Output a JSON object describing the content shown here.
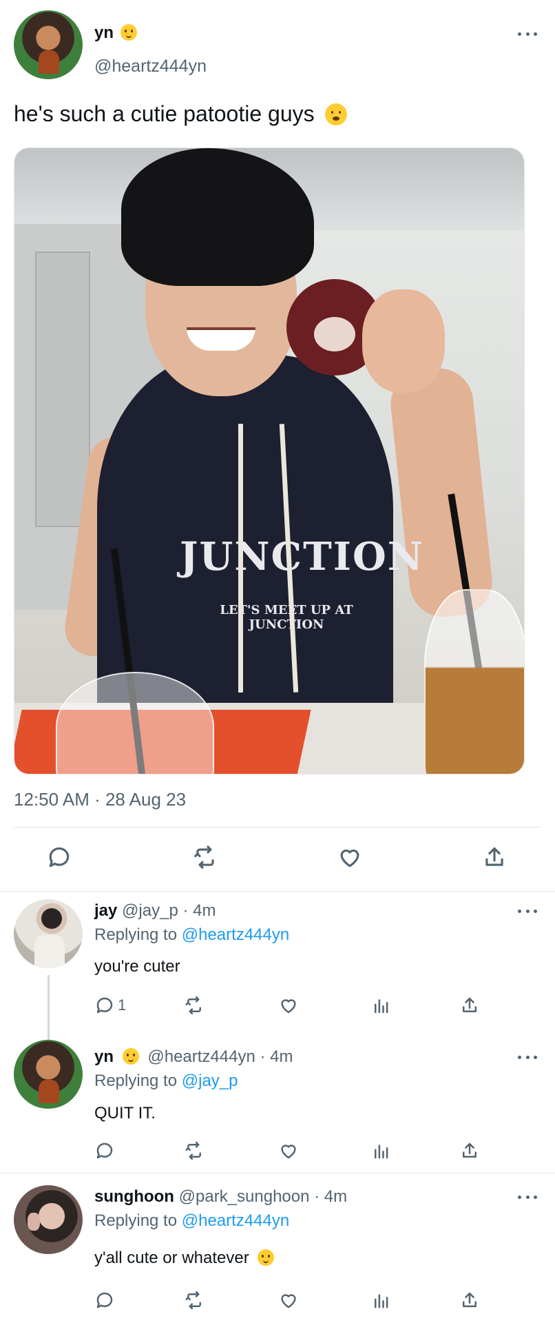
{
  "main_tweet": {
    "name": "yn",
    "handle": "@heartz444yn",
    "text": "he's such a cutie patootie guys",
    "photo_text": {
      "big": "JUNCTION",
      "sub": "LET'S MEET UP AT JUNCTION"
    },
    "timestamp": "12:50 AM · 28 Aug 23"
  },
  "icons": {
    "reply": "reply-icon",
    "retweet": "retweet-icon",
    "like": "heart-icon",
    "share": "share-icon",
    "views": "views-icon",
    "more": "more-icon"
  },
  "replies": [
    {
      "name": "jay",
      "handle": "@jay_p · 4m",
      "replying_label": "Replying to",
      "replying_to": "@heartz444yn",
      "text": "you're cuter",
      "reply_count": "1"
    },
    {
      "name": "yn",
      "handle": "@heartz444yn · 4m",
      "replying_label": "Replying to",
      "replying_to": "@jay_p",
      "text": "QUIT IT.",
      "reply_count": ""
    },
    {
      "name": "sunghoon",
      "handle": "@park_sunghoon · 4m",
      "replying_label": "Replying to",
      "replying_to": "@heartz444yn",
      "text": "y'all cute or whatever",
      "reply_count": ""
    }
  ],
  "colors": {
    "link_blue": "#1d9bf0",
    "muted": "#536471",
    "text": "#0f1419"
  }
}
